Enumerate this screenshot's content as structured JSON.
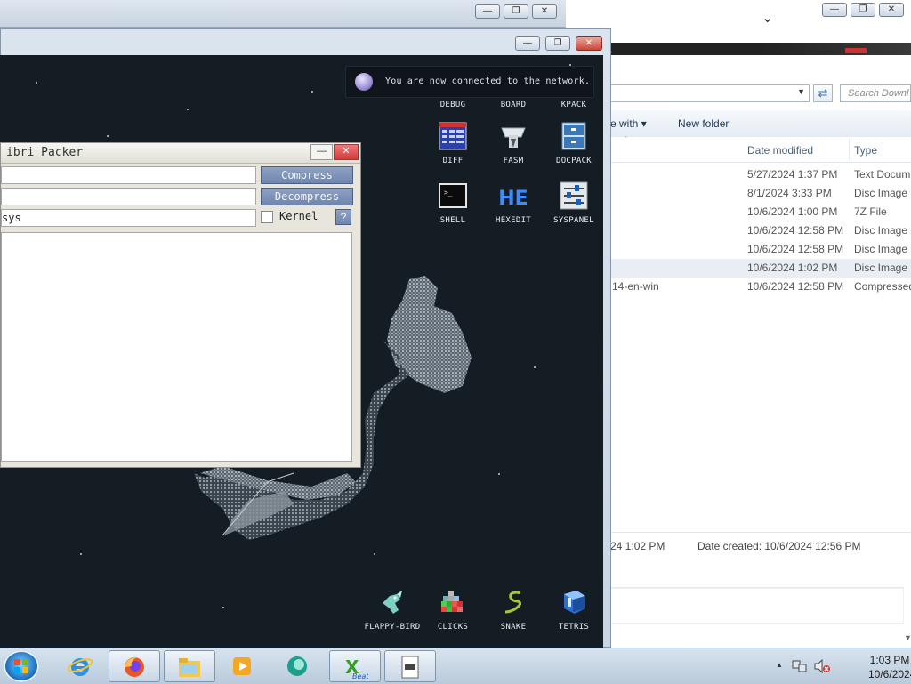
{
  "explorer": {
    "search_placeholder": "Search Downl",
    "toolbar": {
      "share_with": "e with",
      "new_folder": "New folder"
    },
    "columns": {
      "date_modified": "Date modified",
      "type": "Type"
    },
    "rows": [
      {
        "name": "",
        "date": "5/27/2024 1:37 PM",
        "type": "Text Docum"
      },
      {
        "name": "",
        "date": "8/1/2024 3:33 PM",
        "type": "Disc Image F"
      },
      {
        "name": "",
        "date": "10/6/2024 1:00 PM",
        "type": "7Z File"
      },
      {
        "name": "",
        "date": "10/6/2024 12:58 PM",
        "type": "Disc Image F"
      },
      {
        "name": "",
        "date": "10/6/2024 12:58 PM",
        "type": "Disc Image F"
      },
      {
        "name": "",
        "date": "10/6/2024 1:02 PM",
        "type": "Disc Image F"
      },
      {
        "name": "14-en-win",
        "date": "10/6/2024 12:58 PM",
        "type": "Compressed"
      }
    ],
    "details": {
      "modified": "24 1:02 PM",
      "created": "Date created: 10/6/2024 12:56 PM"
    }
  },
  "notification": {
    "text": "You are now connected to the network."
  },
  "desktop_icons_top": [
    "DEBUG",
    "BOARD",
    "KPACK"
  ],
  "desktop_icons": [
    {
      "label": "DIFF",
      "icon": "diff-icon"
    },
    {
      "label": "FASM",
      "icon": "fasm-icon"
    },
    {
      "label": "DOCPACK",
      "icon": "docpack-icon"
    },
    {
      "label": "SHELL",
      "icon": "shell-icon"
    },
    {
      "label": "HEXEDIT",
      "icon": "hexedit-icon",
      "glyph_text": "HE"
    },
    {
      "label": "SYSPANEL",
      "icon": "syspanel-icon"
    },
    {
      "label": "FLAPPY-BIRD",
      "icon": "flappy-bird-icon"
    },
    {
      "label": "CLICKS",
      "icon": "clicks-icon"
    },
    {
      "label": "SNAKE",
      "icon": "snake-icon"
    },
    {
      "label": "TETRIS",
      "icon": "tetris-icon"
    }
  ],
  "packer": {
    "title": "ibri Packer",
    "input1": "",
    "input2": "",
    "input3": "sys",
    "compress": "Compress",
    "decompress": "Decompress",
    "kernel": "Kernel",
    "help": "?"
  },
  "taskbar": {
    "time": "1:03 PM",
    "date": "10/6/2024",
    "apps": [
      "internet-explorer-icon",
      "firefox-icon",
      "explorer-icon",
      "media-player-icon",
      "browser-icon",
      "xbeat-icon",
      "document-icon"
    ],
    "xbeat_label": "Beat"
  },
  "colors": {
    "desktop_bg": "#141c24",
    "accent": "#6f86ae"
  }
}
